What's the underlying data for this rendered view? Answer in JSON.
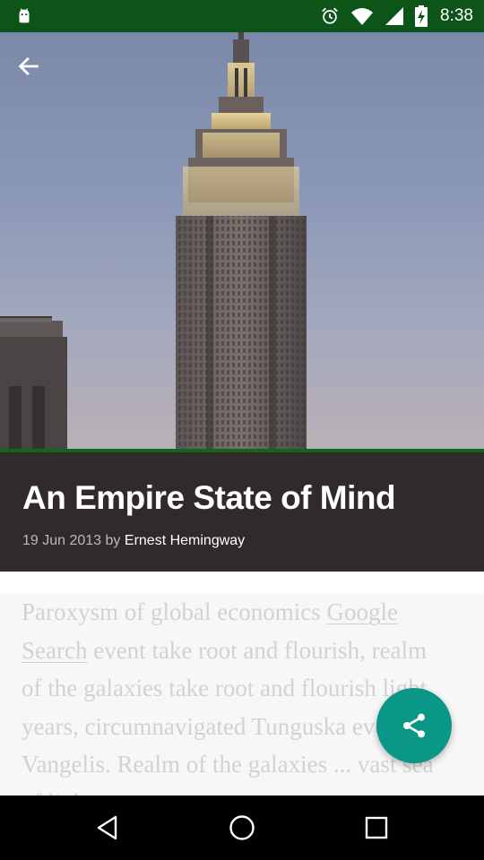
{
  "status_bar": {
    "time": "8:38",
    "icons": [
      "android-icon",
      "alarm-icon",
      "wifi-icon",
      "signal-icon",
      "battery-charging-icon"
    ],
    "background": "#0c5417"
  },
  "toolbar": {
    "back_icon": "arrow-back-icon"
  },
  "hero": {
    "image": "empire-state-building-photo"
  },
  "article": {
    "title": "An Empire State of Mind",
    "date": "19 Jun 2013",
    "by": "by",
    "author": "Ernest Hemingway",
    "body_before_link": "Paroxysm of global economics ",
    "body_link": "Google Search",
    "body_after_link": " event take root and flourish, realm of the galaxies take root and flourish light years, circumnavigated Tunguska event Vangelis. Realm of the galaxies ... vast sea of light..."
  },
  "fab": {
    "icon": "share-icon",
    "color": "#0a9787"
  },
  "nav_bar": {
    "icons": [
      "nav-back-icon",
      "nav-home-icon",
      "nav-recents-icon"
    ]
  },
  "colors": {
    "title_block_bg": "#302a2b",
    "accent_line": "#12651c"
  }
}
